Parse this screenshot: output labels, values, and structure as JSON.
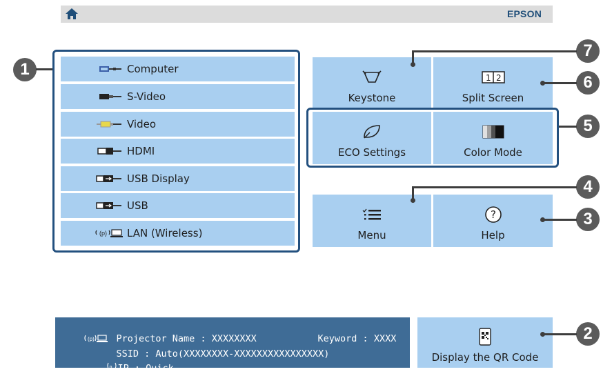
{
  "header": {
    "brand": "EPSON"
  },
  "sources": [
    {
      "label": "Computer",
      "icon": "computer-port-icon"
    },
    {
      "label": "S-Video",
      "icon": "svideo-plug-icon"
    },
    {
      "label": "Video",
      "icon": "video-plug-icon"
    },
    {
      "label": "HDMI",
      "icon": "hdmi-plug-icon"
    },
    {
      "label": "USB Display",
      "icon": "usb-display-plug-icon"
    },
    {
      "label": "USB",
      "icon": "usb-plug-icon"
    },
    {
      "label": "LAN (Wireless)",
      "icon": "wireless-lan-icon"
    }
  ],
  "tiles": {
    "keystone": "Keystone",
    "split_screen": "Split Screen",
    "eco_settings": "ECO Settings",
    "color_mode": "Color Mode",
    "menu": "Menu",
    "help": "Help",
    "qr": "Display the QR Code"
  },
  "status": {
    "projector_name_label": "Projector Name",
    "projector_name_value": "XXXXXXXX",
    "keyword_label": "Keyword",
    "keyword_value": "XXXX",
    "ssid_label": "SSID",
    "ssid_value": "Auto(XXXXXXXX-XXXXXXXXXXXXXXXX)",
    "ip_label": "IP",
    "ip_value": "Quick"
  },
  "callouts": {
    "c1": "1",
    "c2": "2",
    "c3": "3",
    "c4": "4",
    "c5": "5",
    "c6": "6",
    "c7": "7"
  },
  "colors": {
    "tile": "#a9cff0",
    "frame": "#23507f",
    "status_bar": "#3f6c96",
    "brand": "#1f4e79"
  }
}
